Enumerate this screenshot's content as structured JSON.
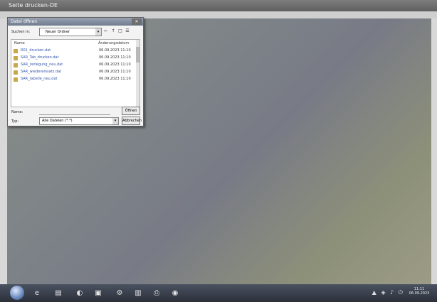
{
  "app": {
    "title": "Seite drucken-DE"
  },
  "dialog": {
    "title": "Datei öffnen",
    "search_label": "Suchen in:",
    "search_value": "Neuer Ordner",
    "list": {
      "headers": [
        "Name",
        "Änderungsdatum"
      ],
      "rows": [
        {
          "name": "R01_drucken.dat",
          "date": "06.09.2023 11:10"
        },
        {
          "name": "SAR_Tab_drucken.dat",
          "date": "06.09.2023 11:10"
        },
        {
          "name": "SAR_zerlegung_neu.dat",
          "date": "06.09.2023 11:10"
        },
        {
          "name": "SAR_wiedereinsatz.dat",
          "date": "06.09.2023 11:10"
        },
        {
          "name": "SAR_tabelle_neu.dat",
          "date": "06.09.2023 11:10"
        }
      ]
    },
    "name_label": "Name:",
    "open_label": "Öffnen",
    "type_label": "Typ:",
    "type_value": "Alle Dateien (*.*)",
    "cancel_label": "Abbrechen"
  },
  "taskbar": {
    "clock_time": "11:11",
    "clock_date": "06.09.2023"
  }
}
